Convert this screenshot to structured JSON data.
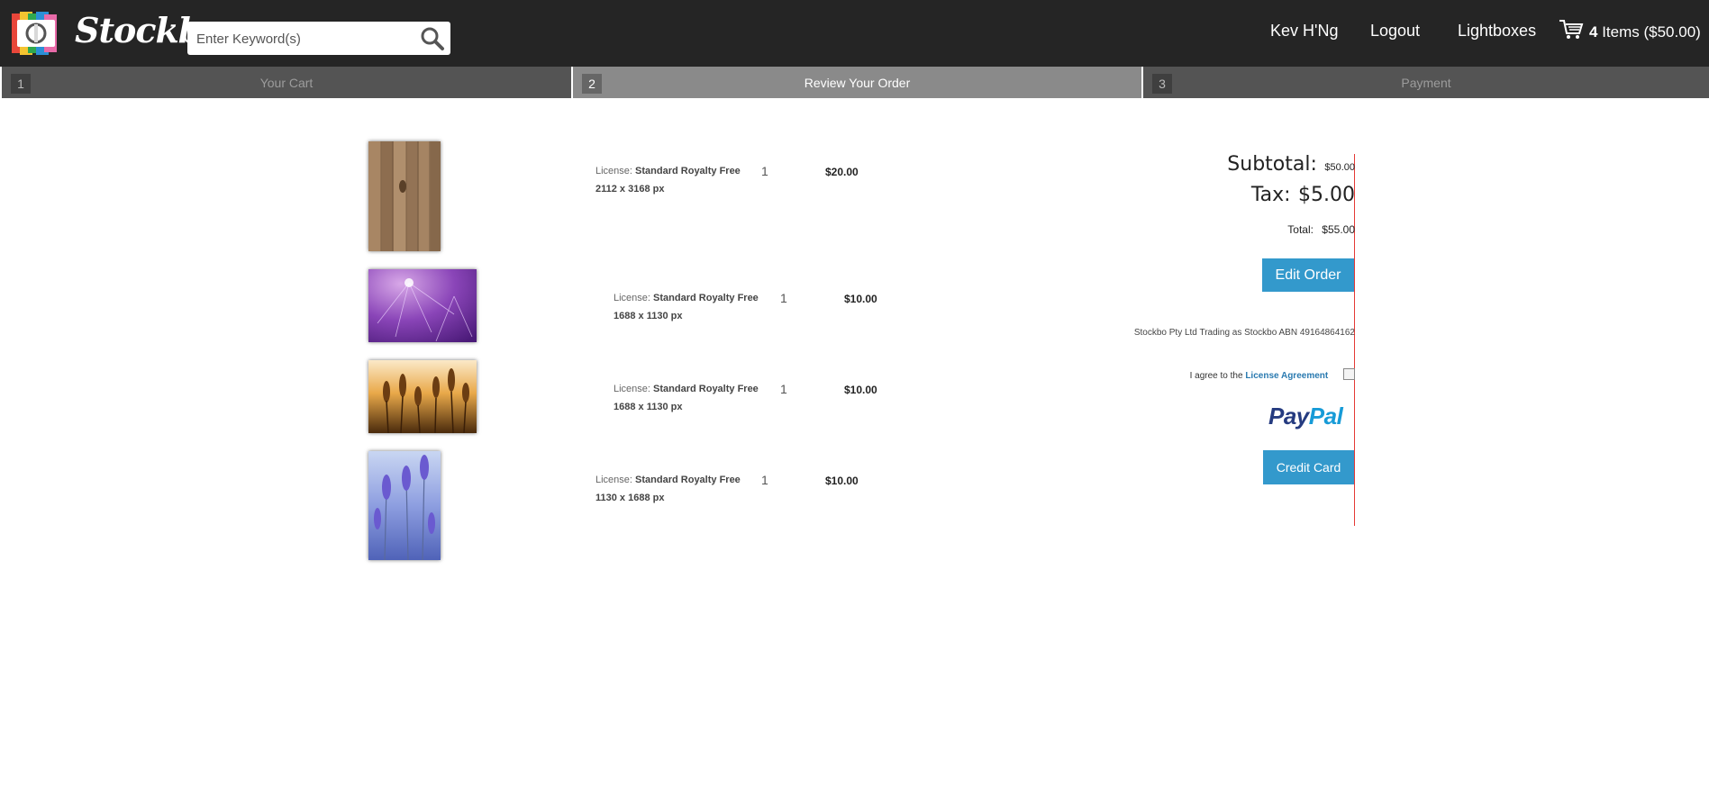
{
  "header": {
    "logo_text": "Stockbo",
    "search_placeholder": "Enter Keyword(s)",
    "nav": {
      "user": "Kev H'Ng",
      "logout": "Logout",
      "lightboxes": "Lightboxes"
    },
    "cart": {
      "count": "4",
      "label": "Items ($50.00)"
    }
  },
  "steps": [
    {
      "num": "1",
      "label": "Your Cart"
    },
    {
      "num": "2",
      "label": "Review Your Order"
    },
    {
      "num": "3",
      "label": "Payment"
    }
  ],
  "items": [
    {
      "license_label": "License:",
      "license": "Standard Royalty Free",
      "size": "2112 x 3168 px",
      "qty": "1",
      "price": "$20.00",
      "image": "wood-texture"
    },
    {
      "license_label": "License:",
      "license": "Standard Royalty Free",
      "size": "1688 x 1130 px",
      "qty": "1",
      "price": "$10.00",
      "image": "purple-dandelion"
    },
    {
      "license_label": "License:",
      "license": "Standard Royalty Free",
      "size": "1688 x 1130 px",
      "qty": "1",
      "price": "$10.00",
      "image": "wheat-sunset"
    },
    {
      "license_label": "License:",
      "license": "Standard Royalty Free",
      "size": "1130 x 1688 px",
      "qty": "1",
      "price": "$10.00",
      "image": "lavender-field"
    }
  ],
  "summary": {
    "subtotal_label": "Subtotal:",
    "subtotal": "$50.00",
    "tax_label": "Tax:",
    "tax": "$5.00",
    "total_label": "Total:",
    "total": "$55.00",
    "edit_order": "Edit Order",
    "legal": "Stockbo Pty Ltd Trading as Stockbo ABN 49164864162",
    "agree_text": "I agree to the",
    "agree_link": "License Agreement",
    "paypal_1": "Pay",
    "paypal_2": "Pal",
    "credit_card": "Credit Card"
  },
  "colors": {
    "header_bg": "#252525",
    "step_active": "#8a8a8a",
    "step_inactive": "#545454",
    "accent_blue": "#3399cc",
    "divider_red": "#e53935"
  }
}
